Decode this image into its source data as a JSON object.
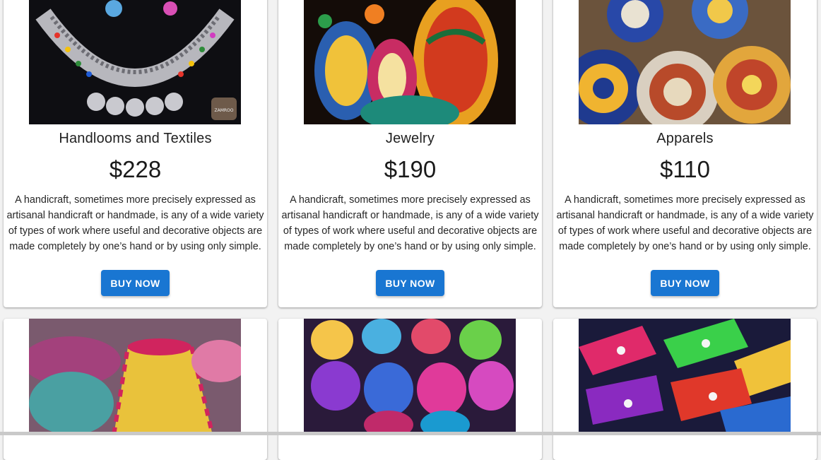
{
  "products": [
    {
      "title": "Handlooms and Textiles",
      "price": "$228",
      "description": "A handicraft, sometimes more precisely expressed as artisanal handicraft or handmade, is any of a wide variety of types of work where useful and decorative objects are made completely by one’s hand or by using only simple.",
      "button": "BUY NOW",
      "image": "silver-necklace-image",
      "image_badge": "ZAMROO"
    },
    {
      "title": "Jewelry",
      "price": "$190",
      "description": "A handicraft, sometimes more precisely expressed as artisanal handicraft or handmade, is any of a wide variety of types of work where useful and decorative objects are made completely by one’s hand or by using only simple.",
      "button": "BUY NOW",
      "image": "painted-pots-image"
    },
    {
      "title": "Apparels",
      "price": "$110",
      "description": "A handicraft, sometimes more precisely expressed as artisanal handicraft or handmade, is any of a wide variety of types of work where useful and decorative objects are made completely by one’s hand or by using only simple.",
      "button": "BUY NOW",
      "image": "painted-plates-image"
    }
  ],
  "second_row_images": [
    "woven-baskets-image",
    "mosaic-lamps-image",
    "embroidered-slippers-image"
  ],
  "colors": {
    "button": "#1976d2",
    "page_background": "#f2f2f2",
    "card": "#ffffff"
  }
}
